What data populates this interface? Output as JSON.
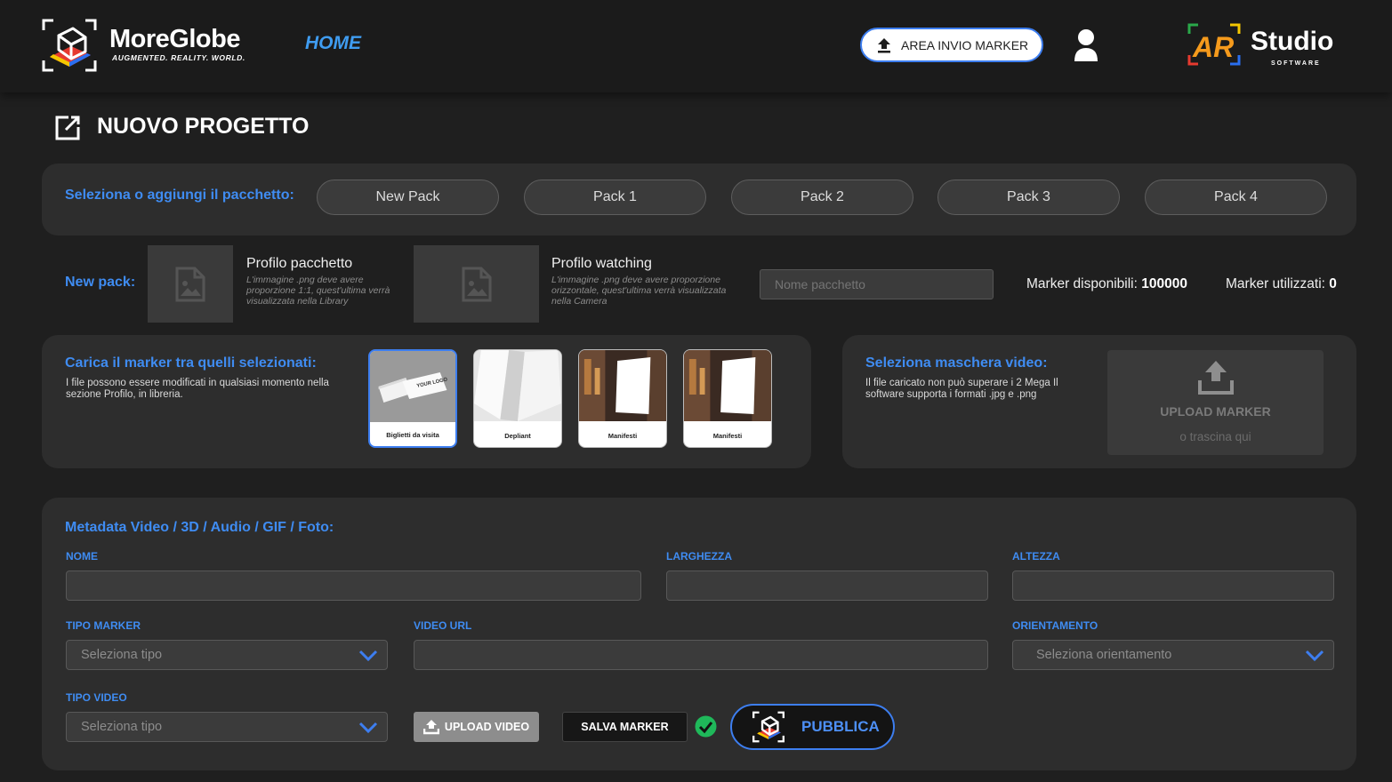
{
  "header": {
    "brand_title": "MoreGlobe",
    "brand_subtitle": "AUGMENTED. REALITY. WORLD.",
    "nav_home": "HOME",
    "area_button": "AREA INVIO MARKER",
    "right_brand": "Studio",
    "right_brand_sub": "SOFTWARE"
  },
  "page": {
    "title": "NUOVO PROGETTO"
  },
  "packs": {
    "label": "Seleziona o aggiungi il pacchetto:",
    "items": [
      "New Pack",
      "Pack 1",
      "Pack 2",
      "Pack 3",
      "Pack 4"
    ]
  },
  "new_pack": {
    "label": "New pack:",
    "profile_title": "Profilo pacchetto",
    "profile_desc": "L'immagine .png deve avere proporzione 1:1, quest'ultima verrà visualizzata nella Library",
    "watching_title": "Profilo watching",
    "watching_desc": "L'immagine .png deve avere proporzione orizzontale, quest'ultima verrà visualizzata nella Camera",
    "name_placeholder": "Nome pacchetto",
    "available_label": "Marker disponibili:",
    "available_value": "100000",
    "used_label": "Marker utilizzati:",
    "used_value": "0"
  },
  "marker": {
    "title": "Carica il marker tra quelli selezionati:",
    "desc": "I file possono essere modificati in qualsiasi momento nella sezione Profilo, in libreria.",
    "thumbs": [
      {
        "label": "Biglietti da visita",
        "selected": true
      },
      {
        "label": "Depliant",
        "selected": false
      },
      {
        "label": "Manifesti",
        "selected": false
      },
      {
        "label": "Manifesti",
        "selected": false
      }
    ],
    "card_text": "YOUR LOGO"
  },
  "mask": {
    "title": "Seleziona maschera video:",
    "desc": "Il file caricato non può superare i 2 Mega Il software supporta i formati .jpg e .png",
    "upload_label": "UPLOAD MARKER",
    "upload_sub": "o trascina qui"
  },
  "metadata": {
    "title": "Metadata Video / 3D / Audio / GIF / Foto:",
    "nome_label": "NOME",
    "larghezza_label": "LARGHEZZA",
    "altezza_label": "ALTEZZA",
    "tipo_marker_label": "TIPO MARKER",
    "tipo_marker_placeholder": "Seleziona tipo",
    "video_url_label": "VIDEO URL",
    "orientamento_label": "ORIENTAMENTO",
    "orientamento_placeholder": "Seleziona orientamento",
    "tipo_video_label": "TIPO VIDEO",
    "tipo_video_placeholder": "Seleziona tipo",
    "upload_video": "UPLOAD VIDEO",
    "salva_marker": "SALVA MARKER",
    "pubblica": "PUBBLICA"
  },
  "colors": {
    "accent": "#3f8cf2",
    "background": "#1f1f1f",
    "panel": "#2d2d2d",
    "success": "#1fb85a"
  },
  "icons": [
    "cube-logo-icon",
    "upload-icon",
    "user-icon",
    "edit-icon",
    "image-placeholder-icon",
    "chevron-down-icon",
    "check-circle-icon"
  ]
}
